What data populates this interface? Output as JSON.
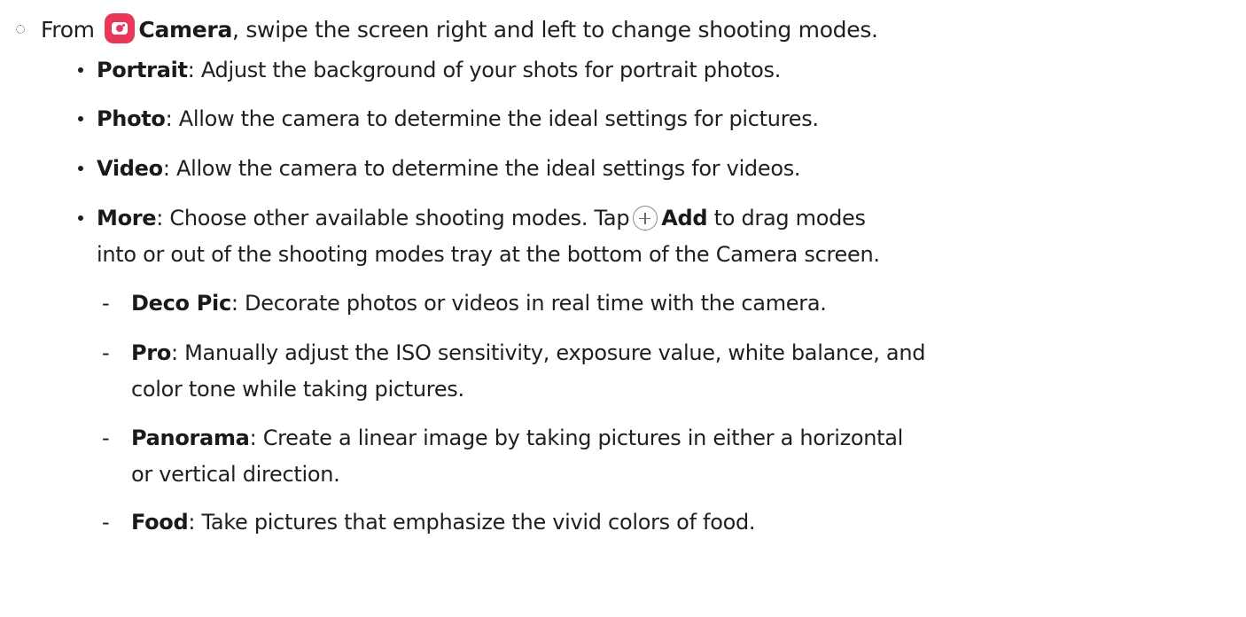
{
  "intro": {
    "prefix": "From",
    "app_name": "Camera",
    "suffix": ", swipe the screen right and left to change shooting modes."
  },
  "modes": [
    {
      "name": "Portrait",
      "sep": ":",
      "desc": " Adjust the background of your shots for portrait photos."
    },
    {
      "name": "Photo",
      "sep": ":",
      "desc": " Allow the camera to determine the ideal settings for pictures."
    },
    {
      "name": "Video",
      "sep": ":",
      "desc": " Allow the camera to determine the ideal settings for videos."
    }
  ],
  "more": {
    "name": "More",
    "sep": ":",
    "desc_before": " Choose other available shooting modes. Tap",
    "add_label": "Add",
    "desc_after": " to drag modes",
    "line2": "into or out of the shooting modes tray at the bottom of the Camera screen."
  },
  "sub_modes": [
    {
      "name": "Deco Pic",
      "sep": ":",
      "desc": " Decorate photos or videos in real time with the camera.",
      "line2": ""
    },
    {
      "name": "Pro",
      "sep": ":",
      "desc": " Manually adjust the ISO sensitivity, exposure value, white balance, and",
      "line2": "color tone while taking pictures."
    },
    {
      "name": "Panorama",
      "sep": ":",
      "desc": " Create a linear image by taking pictures in either a horizontal",
      "line2": "or vertical direction."
    },
    {
      "name": "Food",
      "sep": ":",
      "desc": " Take pictures that emphasize the vivid colors of food.",
      "line2": ""
    }
  ],
  "dash_char": "-",
  "icons": {
    "camera_app": "camera-app-icon",
    "add": "plus-circle-icon"
  },
  "colors": {
    "camera_icon_bg": "#e8385a",
    "text": "#1f1f1f"
  }
}
